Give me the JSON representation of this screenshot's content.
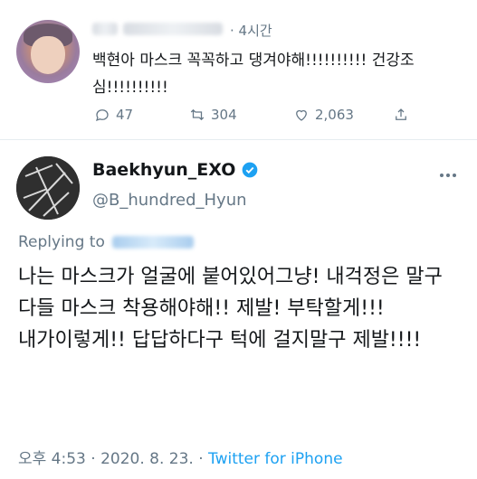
{
  "reply_tweet": {
    "time": "· 4시간",
    "text": "백현아 마스크 꼭꼭하고 댕겨야해!!!!!!!!!! 건강조심!!!!!!!!!!",
    "replies": "47",
    "retweets": "304",
    "likes": "2,063"
  },
  "main_tweet": {
    "display_name": "Baekhyun_EXO",
    "handle": "@B_hundred_Hyun",
    "replying_to": "Replying to",
    "text": "나는 마스크가 얼굴에 붙어있어그냥! 내걱정은 말구 다들 마스크 착용해야해!! 제발! 부탁할게!!! 내가이렇게!! 답답하다구 턱에 걸지말구 제발!!!!",
    "timestamp": "오후 4:53 · 2020. 8. 23. ·",
    "source": "Twitter for iPhone"
  },
  "colors": {
    "link_blue": "#1da1f2",
    "muted": "#657786",
    "text": "#14171a"
  },
  "icons": [
    "reply-icon",
    "retweet-icon",
    "like-icon",
    "share-icon",
    "verified-badge-icon",
    "more-icon"
  ]
}
